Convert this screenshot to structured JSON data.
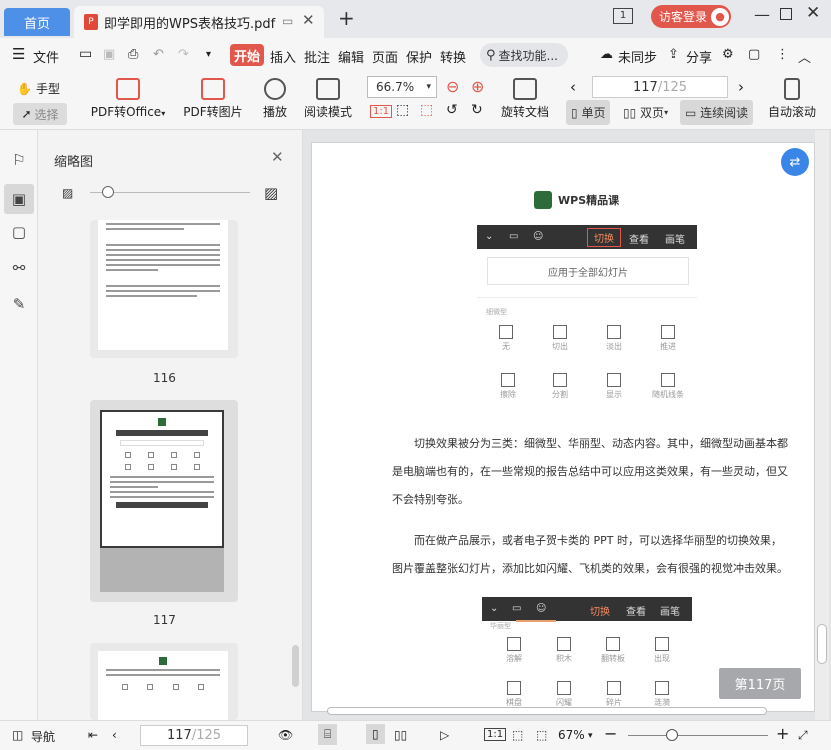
{
  "titlebar": {
    "home_tab": "首页",
    "doc_tab": "即学即用的WPS表格技巧.pdf",
    "new_tab": "+",
    "page_indicator_badge": "1",
    "visitor_login": "访客登录"
  },
  "menubar": {
    "file": "文件",
    "start": "开始",
    "insert": "插入",
    "annotate": "批注",
    "edit": "编辑",
    "page": "页面",
    "protect": "保护",
    "convert": "转换",
    "search": "查找功能...",
    "sync": "未同步",
    "share": "分享"
  },
  "toolbar": {
    "hand": "手型",
    "select": "选择",
    "pdf_to_office": "PDF转Office",
    "pdf_to_image": "PDF转图片",
    "play": "播放",
    "read_mode": "阅读模式",
    "zoom": "66.7%",
    "rotate": "旋转文档",
    "page_current": "117",
    "page_total": "/125",
    "single": "单页",
    "double": "双页",
    "continuous": "连续阅读",
    "autoscroll": "自动滚动"
  },
  "thumbs": {
    "title": "缩略图",
    "page_116": "116",
    "page_117": "117"
  },
  "doc": {
    "logo_text": "WPS精品课",
    "ppt_tabs": [
      "切换",
      "查看",
      "画笔"
    ],
    "apply_all": "应用于全部幻灯片",
    "subtle": "细微型",
    "row1": [
      "无",
      "切出",
      "淡出",
      "推进"
    ],
    "row2": [
      "擦除",
      "分割",
      "显示",
      "随机线条"
    ],
    "para1": "切换效果被分为三类：细微型、华丽型、动态内容。其中，细微型动画基本都是电脑端也有的，在一些常规的报告总结中可以应用这类效果，有一些灵动，但又不会特别夸张。",
    "para2": "而在做产品展示，或者电子贺卡类的 PPT 时，可以选择华丽型的切换效果，图片覆盖整张幻灯片，添加比如闪耀、飞机类的效果，会有很强的视觉冲击效果。",
    "fancy": "华丽型",
    "row3": [
      "溶解",
      "积木",
      "翻转板",
      "出现"
    ],
    "row4": [
      "棋盘",
      "闪耀",
      "碎片",
      "涟漪"
    ],
    "page_badge": "第117页"
  },
  "statusbar": {
    "nav": "导航",
    "page_current": "117",
    "page_total": "/125",
    "zoom": "67%"
  },
  "colors": {
    "accent_red": "#e2574c",
    "home_blue": "#4e8fe8",
    "app_bg": "#f6f6f6"
  }
}
